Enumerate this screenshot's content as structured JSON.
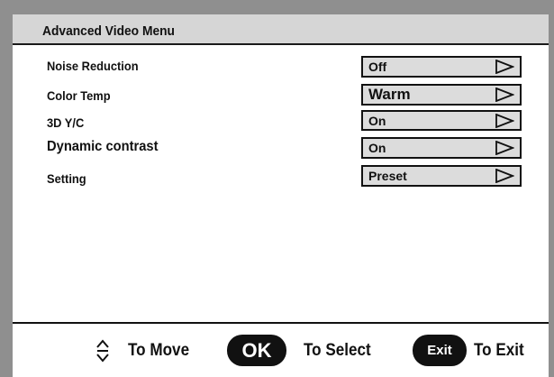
{
  "menu": {
    "title": "Advanced Video Menu",
    "items": [
      {
        "label": "Noise Reduction",
        "value": "Off"
      },
      {
        "label": "Color Temp",
        "value": "Warm"
      },
      {
        "label": "3D Y/C",
        "value": "On"
      },
      {
        "label": "Dynamic contrast",
        "value": "On"
      },
      {
        "label": "Setting",
        "value": "Preset"
      }
    ]
  },
  "footer": {
    "move_label": "To Move",
    "ok_label": "OK",
    "select_label": "To Select",
    "exit_label": "Exit",
    "exit_action": "To Exit"
  },
  "icons": {
    "move": "up-down-arrows-icon",
    "value_arrow": "right-triangle-outline-icon"
  },
  "colors": {
    "frame": "#8f8f8f",
    "title_bar": "#d6d6d6",
    "value_box": "#dcdcdc",
    "pill": "#111111"
  }
}
